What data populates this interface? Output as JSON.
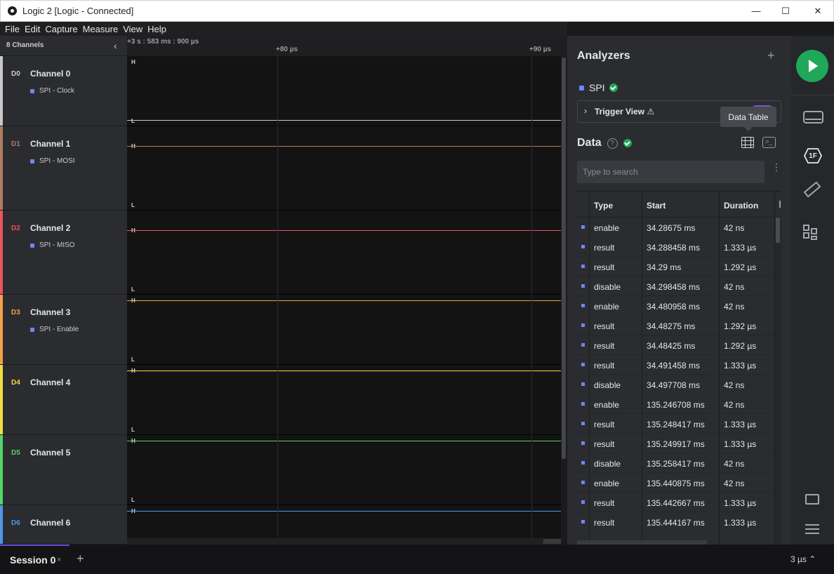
{
  "window": {
    "title": "Logic 2 [Logic - Connected]",
    "min": "—",
    "max": "☐",
    "close": "✕"
  },
  "menu": [
    "File",
    "Edit",
    "Capture",
    "Measure",
    "View",
    "Help"
  ],
  "channels_header": {
    "title": "8 Channels",
    "collapse": "‹"
  },
  "timeline": {
    "offset": "+3 s : 583 ms : 900 µs",
    "ticks": [
      "+80 µs",
      "+90 µs"
    ]
  },
  "levels": {
    "high": "H",
    "low": "L"
  },
  "channels": [
    {
      "id": "D0",
      "name": "Channel 0",
      "analyzer": "SPI - Clock",
      "color": "#c9c9c9"
    },
    {
      "id": "D1",
      "name": "Channel 1",
      "analyzer": "SPI - MOSI",
      "color": "#b07d62"
    },
    {
      "id": "D2",
      "name": "Channel 2",
      "analyzer": "SPI - MISO",
      "color": "#e8545f"
    },
    {
      "id": "D3",
      "name": "Channel 3",
      "analyzer": "SPI - Enable",
      "color": "#f4a049"
    },
    {
      "id": "D4",
      "name": "Channel 4",
      "analyzer": "",
      "color": "#f2de3f"
    },
    {
      "id": "D5",
      "name": "Channel 5",
      "analyzer": "",
      "color": "#52d667"
    },
    {
      "id": "D6",
      "name": "Channel 6",
      "analyzer": "",
      "color": "#4f97ea"
    }
  ],
  "panel": {
    "title": "Analyzers",
    "add": "+",
    "analyzer": {
      "name": "SPI",
      "color": "#6e86ff"
    },
    "trigger": {
      "chevron": "›",
      "label": "Trigger View ⚠"
    },
    "tooltip": "Data Table",
    "data_title": "Data",
    "help": "?",
    "search_placeholder": "Type to search",
    "terminal": ">_",
    "kebab": "⋮",
    "table": {
      "columns": [
        "Type",
        "Start",
        "Duration"
      ],
      "rows": [
        {
          "type": "enable",
          "start": "34.28675 ms",
          "duration": "42 ns"
        },
        {
          "type": "result",
          "start": "34.288458 ms",
          "duration": "1.333 µs"
        },
        {
          "type": "result",
          "start": "34.29 ms",
          "duration": "1.292 µs"
        },
        {
          "type": "disable",
          "start": "34.298458 ms",
          "duration": "42 ns"
        },
        {
          "type": "enable",
          "start": "34.480958 ms",
          "duration": "42 ns"
        },
        {
          "type": "result",
          "start": "34.48275 ms",
          "duration": "1.292 µs"
        },
        {
          "type": "result",
          "start": "34.48425 ms",
          "duration": "1.292 µs"
        },
        {
          "type": "result",
          "start": "34.491458 ms",
          "duration": "1.333 µs"
        },
        {
          "type": "disable",
          "start": "34.497708 ms",
          "duration": "42 ns"
        },
        {
          "type": "enable",
          "start": "135.246708 ms",
          "duration": "42 ns"
        },
        {
          "type": "result",
          "start": "135.248417 ms",
          "duration": "1.333 µs"
        },
        {
          "type": "result",
          "start": "135.249917 ms",
          "duration": "1.333 µs"
        },
        {
          "type": "disable",
          "start": "135.258417 ms",
          "duration": "42 ns"
        },
        {
          "type": "enable",
          "start": "135.440875 ms",
          "duration": "42 ns"
        },
        {
          "type": "result",
          "start": "135.442667 ms",
          "duration": "1.333 µs"
        },
        {
          "type": "result",
          "start": "135.444167 ms",
          "duration": "1.333 µs"
        }
      ]
    }
  },
  "rail": {
    "ic_1f": "1F"
  },
  "session": {
    "tab": "Session 0",
    "close": "×",
    "add": "+",
    "zoom": "3 µs ⌃"
  }
}
